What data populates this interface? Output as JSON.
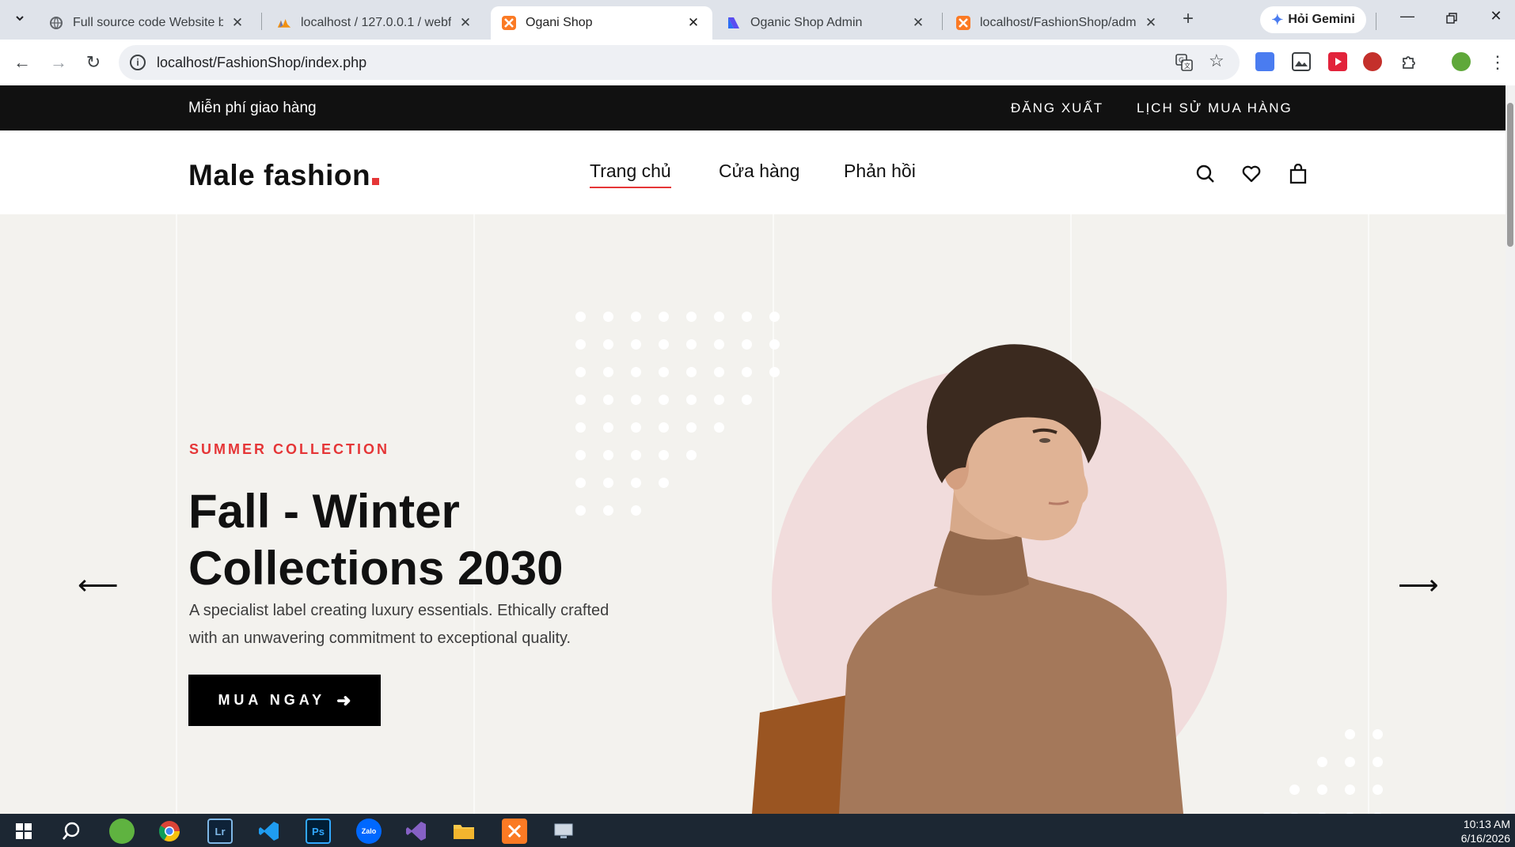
{
  "browser": {
    "tabs": [
      {
        "title": "Full source code Website bán",
        "icon": "globe-icon"
      },
      {
        "title": "localhost / 127.0.0.1 / webfast",
        "icon": "phpmyadmin-icon"
      },
      {
        "title": "Ogani Shop",
        "icon": "xampp-icon",
        "active": true
      },
      {
        "title": "Oganic Shop Admin",
        "icon": "admin-icon"
      },
      {
        "title": "localhost/FashionShop/admin",
        "icon": "xampp-icon"
      }
    ],
    "gemini_label": "Hỏi Gemini",
    "url": "localhost/FashionShop/index.php"
  },
  "site": {
    "topbar": {
      "shipping": "Miễn phí giao hàng",
      "links": [
        "ĐĂNG XUẤT",
        "LỊCH SỬ MUA HÀNG"
      ]
    },
    "logo": "Male fashion",
    "menu": [
      "Trang chủ",
      "Cửa hàng",
      "Phản hồi"
    ],
    "hero": {
      "eyebrow": "SUMMER COLLECTION",
      "headline_line1": "Fall - Winter",
      "headline_line2": "Collections 2030",
      "lede": "A specialist label creating luxury essentials. Ethically crafted with an unwavering commitment to exceptional quality.",
      "cta": "MUA NGAY"
    }
  },
  "taskbar": {
    "time": "10:13 AM",
    "date": "6/16/2026"
  },
  "colors": {
    "accent": "#e53637",
    "hero_bg": "#f3f2ee",
    "circle": "#f1dcdc",
    "sweater": "#a4785a"
  }
}
